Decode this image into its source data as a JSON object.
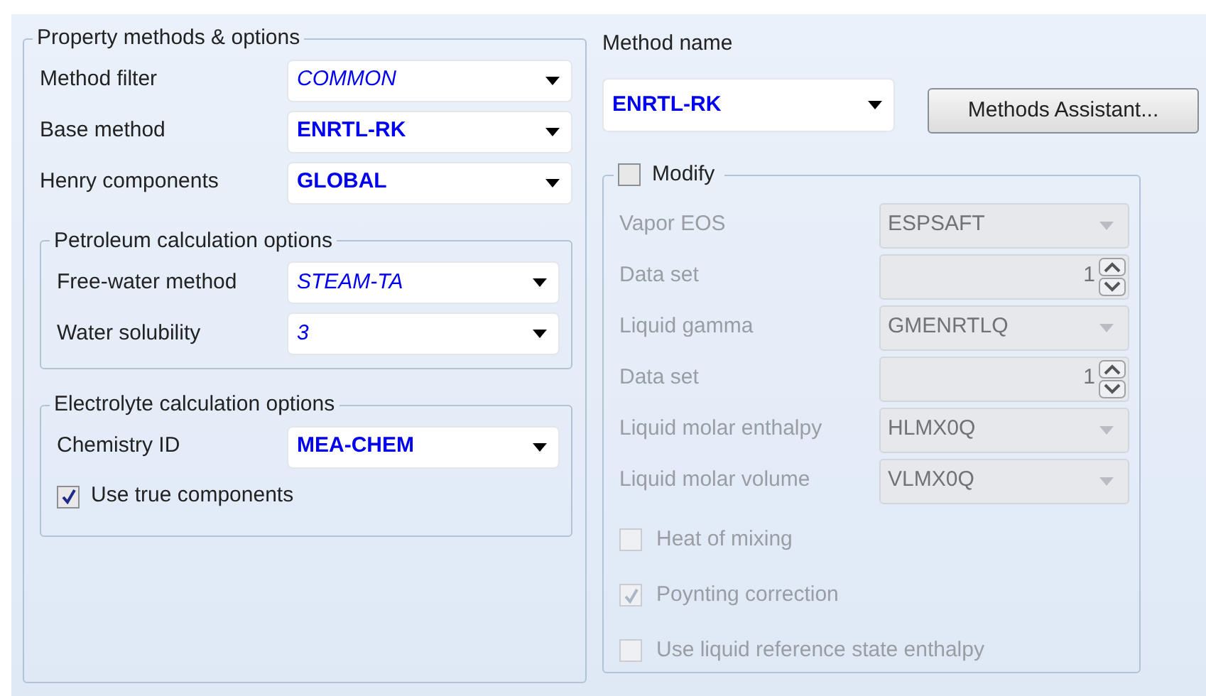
{
  "property_methods": {
    "title": "Property methods & options",
    "fields": [
      {
        "label": "Method filter",
        "value": "COMMON",
        "kind": "italic"
      },
      {
        "label": "Base method",
        "value": "ENRTL-RK",
        "kind": "bold"
      },
      {
        "label": "Henry components",
        "value": "GLOBAL",
        "kind": "bold"
      }
    ],
    "petroleum": {
      "title": "Petroleum calculation options",
      "fields": [
        {
          "label": "Free-water method",
          "value": "STEAM-TA",
          "kind": "italic"
        },
        {
          "label": "Water solubility",
          "value": "3",
          "kind": "italic"
        }
      ]
    },
    "electrolyte": {
      "title": "Electrolyte calculation options",
      "fields": [
        {
          "label": "Chemistry ID",
          "value": "MEA-CHEM",
          "kind": "bold"
        }
      ],
      "checkbox": {
        "label": "Use true components",
        "checked": true
      }
    }
  },
  "method_name": {
    "label": "Method name",
    "value": "ENRTL-RK",
    "kind": "bold"
  },
  "methods_assistant_button": "Methods Assistant...",
  "modify": {
    "label": "Modify",
    "checked": false,
    "rows": [
      {
        "kind": "select",
        "label": "Vapor EOS",
        "value": "ESPSAFT",
        "disabled": true
      },
      {
        "kind": "spinner",
        "label": "Data set",
        "value": "1",
        "disabled": true
      },
      {
        "kind": "select",
        "label": "Liquid gamma",
        "value": "GMENRTLQ",
        "disabled": true
      },
      {
        "kind": "spinner",
        "label": "Data set",
        "value": "1",
        "disabled": true
      },
      {
        "kind": "select",
        "label": "Liquid molar enthalpy",
        "value": "HLMX0Q",
        "disabled": true
      },
      {
        "kind": "select",
        "label": "Liquid molar volume",
        "value": "VLMX0Q",
        "disabled": true
      }
    ],
    "options": [
      {
        "label": "Heat of mixing",
        "checked": false,
        "disabled": true
      },
      {
        "label": "Poynting correction",
        "checked": true,
        "disabled": true
      },
      {
        "label": "Use liquid reference state enthalpy",
        "checked": false,
        "disabled": true
      }
    ]
  }
}
